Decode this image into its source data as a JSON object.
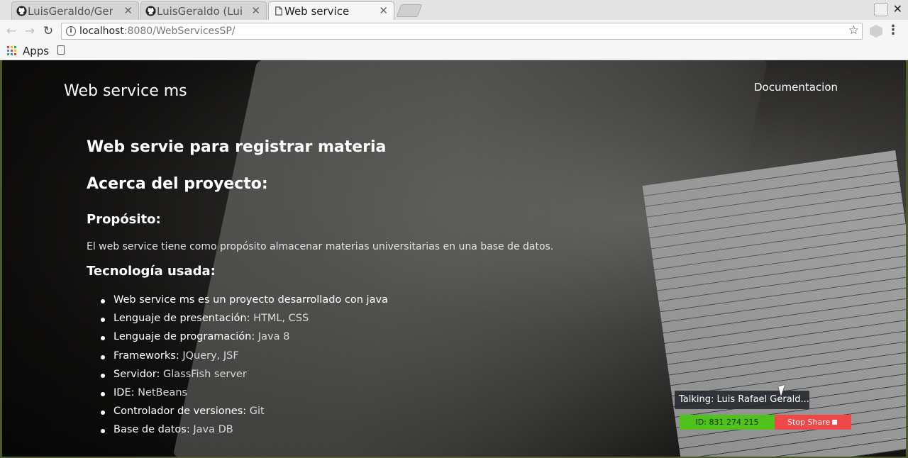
{
  "browser": {
    "tabs": [
      {
        "title": "LuisGeraldo/Gen",
        "icon": "github-icon",
        "active": false
      },
      {
        "title": "LuisGeraldo (Luis",
        "icon": "github-icon",
        "active": false
      },
      {
        "title": "Web service",
        "icon": "page-icon",
        "active": true
      }
    ],
    "url_host": "localhost",
    "url_rest": ":8080/WebServicesSP/",
    "bookmarks": {
      "apps_label": "Apps"
    }
  },
  "site": {
    "brand": "Web service ms",
    "nav_link": "Documentacion",
    "heading_main": "Web servie para registrar materia",
    "heading_about": "Acerca del proyecto:",
    "heading_purpose": "Propósito:",
    "purpose_text": "El web service tiene como propósito almacenar materias universitarias en una base de datos.",
    "heading_tech": "Tecnología usada:",
    "tech_list": [
      {
        "key": "Web service ms es un proyecto desarrollado con java",
        "value": ""
      },
      {
        "key": "Lenguaje de presentación:",
        "value": " HTML, CSS"
      },
      {
        "key": "Lenguaje de programación:",
        "value": " Java 8"
      },
      {
        "key": "Frameworks:",
        "value": " JQuery, JSF"
      },
      {
        "key": "Servidor:",
        "value": " GlassFish server"
      },
      {
        "key": "IDE:",
        "value": " NetBeans"
      },
      {
        "key": "Controlador de versiones:",
        "value": " Git"
      },
      {
        "key": "Base de datos:",
        "value": " Java DB"
      }
    ]
  },
  "share_overlay": {
    "talking": "Talking: Luis Rafael Gerald...",
    "id_label": "ID: 831 274 215",
    "stop_label": "Stop Share"
  },
  "colors": {
    "share_green": "#4fc21c",
    "share_red": "#ef4848"
  }
}
